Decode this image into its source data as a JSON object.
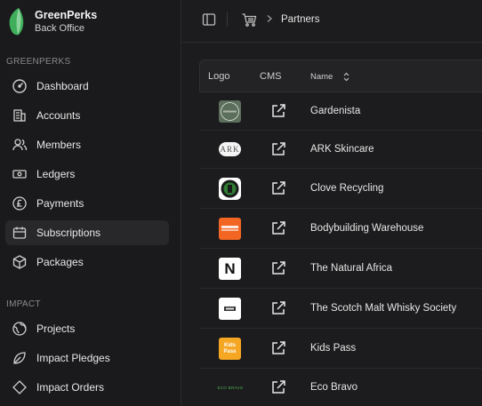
{
  "brand": {
    "name": "GreenPerks",
    "subtitle": "Back Office"
  },
  "sidebar": {
    "sections": [
      {
        "label": "GREENPERKS"
      },
      {
        "label": "IMPACT"
      }
    ],
    "items": [
      {
        "label": "Dashboard",
        "icon": "gauge-icon"
      },
      {
        "label": "Accounts",
        "icon": "building-icon"
      },
      {
        "label": "Members",
        "icon": "users-icon"
      },
      {
        "label": "Ledgers",
        "icon": "banknote-icon"
      },
      {
        "label": "Payments",
        "icon": "pound-coin-icon"
      },
      {
        "label": "Subscriptions",
        "icon": "calendar-icon",
        "active": true
      },
      {
        "label": "Packages",
        "icon": "package-icon"
      },
      {
        "label": "Projects",
        "icon": "globe-icon"
      },
      {
        "label": "Impact Pledges",
        "icon": "leaf-icon"
      },
      {
        "label": "Impact Orders",
        "icon": "diamond-icon"
      }
    ]
  },
  "topbar": {
    "breadcrumb": "Partners"
  },
  "table": {
    "headers": {
      "logo": "Logo",
      "cms": "CMS",
      "name": "Name"
    },
    "rows": [
      {
        "name": "Gardenista",
        "logo_text": "Gardenista",
        "logo_bg": "#5c6e5c"
      },
      {
        "name": "ARK Skincare",
        "logo_text": "ARK",
        "logo_bg": "#f4f4f4"
      },
      {
        "name": "Clove Recycling",
        "logo_text": "",
        "logo_bg": "#ffffff"
      },
      {
        "name": "Bodybuilding Warehouse",
        "logo_text": "",
        "logo_bg": "#f26522"
      },
      {
        "name": "The Natural Africa",
        "logo_text": "N",
        "logo_bg": "#ffffff"
      },
      {
        "name": "The Scotch Malt Whisky Society",
        "logo_text": "",
        "logo_bg": "#ffffff"
      },
      {
        "name": "Kids Pass",
        "logo_text": "Kids Pass",
        "logo_bg": "#f5a623"
      },
      {
        "name": "Eco Bravo",
        "logo_text": "ECO BRAVO",
        "logo_bg": "#1c1c1e"
      }
    ]
  },
  "colors": {
    "accent": "#4caf50",
    "background": "#1c1c1e",
    "sidebar": "#1a1a1c"
  }
}
